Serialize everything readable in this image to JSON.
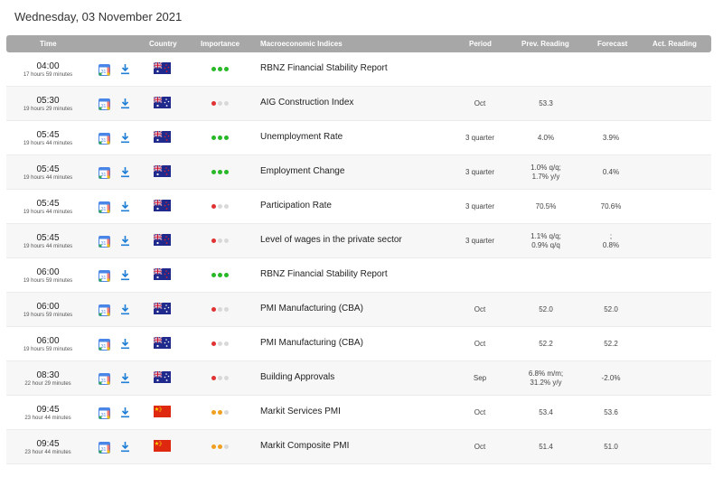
{
  "date_title": "Wednesday, 03 November 2021",
  "colors": {
    "header_bg": "#a7a7a7",
    "dot_green": "#28b828",
    "dot_orange": "#f0a020",
    "dot_red": "#e03232",
    "dot_grey": "#d9d9d9",
    "icon_blue": "#1f7fd6"
  },
  "headers": {
    "time": "Time",
    "country": "Country",
    "importance": "Importance",
    "indicator": "Macroeconomic Indices",
    "period": "Period",
    "prev": "Prev. Reading",
    "forecast": "Forecast",
    "actual": "Act. Reading"
  },
  "icons": {
    "calendar": "calendar-icon",
    "download": "download-icon"
  },
  "rows": [
    {
      "time": "04:00",
      "remaining": "17 hours 59 minutes",
      "country": "new-zealand",
      "importance": "high",
      "indicator": "RBNZ Financial Stability Report",
      "period": "",
      "prev": "",
      "forecast": "",
      "actual": ""
    },
    {
      "time": "05:30",
      "remaining": "19 hours 29 minutes",
      "country": "australia",
      "importance": "low",
      "indicator": "AIG Construction Index",
      "period": "Oct",
      "prev": "53.3",
      "forecast": "",
      "actual": ""
    },
    {
      "time": "05:45",
      "remaining": "19 hours 44 minutes",
      "country": "new-zealand",
      "importance": "high",
      "indicator": "Unemployment Rate",
      "period": "3 quarter",
      "prev": "4.0%",
      "forecast": "3.9%",
      "actual": ""
    },
    {
      "time": "05:45",
      "remaining": "19 hours 44 minutes",
      "country": "new-zealand",
      "importance": "high",
      "indicator": "Employment Change",
      "period": "3 quarter",
      "prev": "1.0% q/q;\n1.7% y/y",
      "forecast": "0.4%",
      "actual": ""
    },
    {
      "time": "05:45",
      "remaining": "19 hours 44 minutes",
      "country": "new-zealand",
      "importance": "low",
      "indicator": "Participation Rate",
      "period": "3 quarter",
      "prev": "70.5%",
      "forecast": "70.6%",
      "actual": ""
    },
    {
      "time": "05:45",
      "remaining": "19 hours 44 minutes",
      "country": "new-zealand",
      "importance": "low",
      "indicator": "Level of wages in the private sector",
      "period": "3 quarter",
      "prev": "1.1% q/q;\n0.9% q/q",
      "forecast": ";\n0.8%",
      "actual": ""
    },
    {
      "time": "06:00",
      "remaining": "19 hours 59 minutes",
      "country": "new-zealand",
      "importance": "high",
      "indicator": "RBNZ Financial Stability Report",
      "period": "",
      "prev": "",
      "forecast": "",
      "actual": ""
    },
    {
      "time": "06:00",
      "remaining": "19 hours 59 minutes",
      "country": "australia",
      "importance": "low",
      "indicator": "PMI Manufacturing (CBA)",
      "period": "Oct",
      "prev": "52.0",
      "forecast": "52.0",
      "actual": ""
    },
    {
      "time": "06:00",
      "remaining": "19 hours 59 minutes",
      "country": "australia",
      "importance": "low",
      "indicator": "PMI Manufacturing (CBA)",
      "period": "Oct",
      "prev": "52.2",
      "forecast": "52.2",
      "actual": ""
    },
    {
      "time": "08:30",
      "remaining": "22 hour 29 minutes",
      "country": "australia",
      "importance": "low",
      "indicator": "Building Approvals",
      "period": "Sep",
      "prev": "6.8% m/m;\n31.2% y/y",
      "forecast": "-2.0%",
      "actual": ""
    },
    {
      "time": "09:45",
      "remaining": "23 hour 44 minutes",
      "country": "china",
      "importance": "medium",
      "indicator": "Markit Services PMI",
      "period": "Oct",
      "prev": "53.4",
      "forecast": "53.6",
      "actual": ""
    },
    {
      "time": "09:45",
      "remaining": "23 hour 44 minutes",
      "country": "china",
      "importance": "medium",
      "indicator": "Markit Composite PMI",
      "period": "Oct",
      "prev": "51.4",
      "forecast": "51.0",
      "actual": ""
    }
  ]
}
